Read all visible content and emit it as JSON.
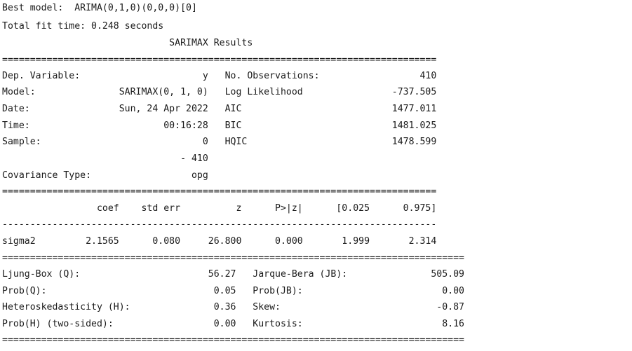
{
  "header": {
    "best_model": "Best model:  ARIMA(0,1,0)(0,0,0)[0]",
    "fit_time": "Total fit time: 0.248 seconds"
  },
  "summary": {
    "title": "                              SARIMAX Results",
    "sep_eq": "==============================================================================",
    "model_info": [
      "Dep. Variable:                      y   No. Observations:                  410",
      "Model:               SARIMAX(0, 1, 0)   Log Likelihood                -737.505",
      "Date:                Sun, 24 Apr 2022   AIC                           1477.011",
      "Time:                        00:16:28   BIC                           1481.025",
      "Sample:                             0   HQIC                          1478.599",
      "                                - 410",
      "Covariance Type:                  opg"
    ],
    "coef_header": "                 coef    std err          z      P>|z|      [0.025      0.975]",
    "sep_dash": "------------------------------------------------------------------------------",
    "coef_rows": [
      "sigma2         2.1565      0.080     26.800      0.000       1.999       2.314"
    ],
    "sep_eq_long": "===================================================================================",
    "diagnostics": [
      "Ljung-Box (Q):                       56.27   Jarque-Bera (JB):               505.09",
      "Prob(Q):                              0.05   Prob(JB):                         0.00",
      "Heteroskedasticity (H):               0.36   Skew:                            -0.87",
      "Prob(H) (two-sided):                  0.00   Kurtosis:                         8.16"
    ]
  }
}
